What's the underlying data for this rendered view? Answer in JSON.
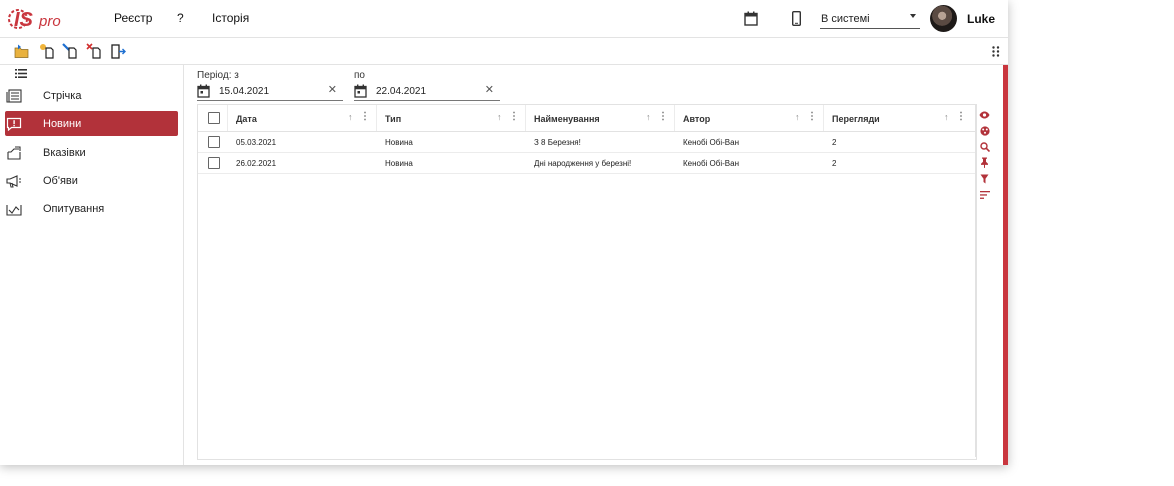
{
  "header": {
    "logo_text": "ISpro",
    "nav": [
      "Реєстр",
      "?",
      "Історія"
    ],
    "status_value": "В системі",
    "user_name": "Luke"
  },
  "toolbar_icons": [
    "open-folder-icon",
    "add-doc-icon",
    "edit-doc-icon",
    "delete-doc-icon",
    "exit-icon"
  ],
  "sidebar": {
    "items": [
      {
        "label": "Стрічка",
        "icon": "feed-icon",
        "active": false
      },
      {
        "label": "Новини",
        "icon": "news-icon",
        "active": true
      },
      {
        "label": "Вказівки",
        "icon": "directive-icon",
        "active": false
      },
      {
        "label": "Об'яви",
        "icon": "announcement-icon",
        "active": false
      },
      {
        "label": "Опитування",
        "icon": "poll-icon",
        "active": false
      }
    ]
  },
  "filters": {
    "period_label": "Період: з",
    "from_date": "15.04.2021",
    "to_label": "по",
    "to_date": "22.04.2021"
  },
  "grid": {
    "columns": [
      "Дата",
      "Тип",
      "Найменування",
      "Автор",
      "Перегляди"
    ],
    "rows": [
      [
        "05.03.2021",
        "Новина",
        "З 8 Березня!",
        "Кенобі Обі-Ван",
        "2"
      ],
      [
        "26.02.2021",
        "Новина",
        "Дні народження у березні!",
        "Кенобі Обі-Ван",
        "2"
      ]
    ]
  },
  "colors": {
    "accent": "#b2323a",
    "scrollbar": "#c9363e"
  }
}
